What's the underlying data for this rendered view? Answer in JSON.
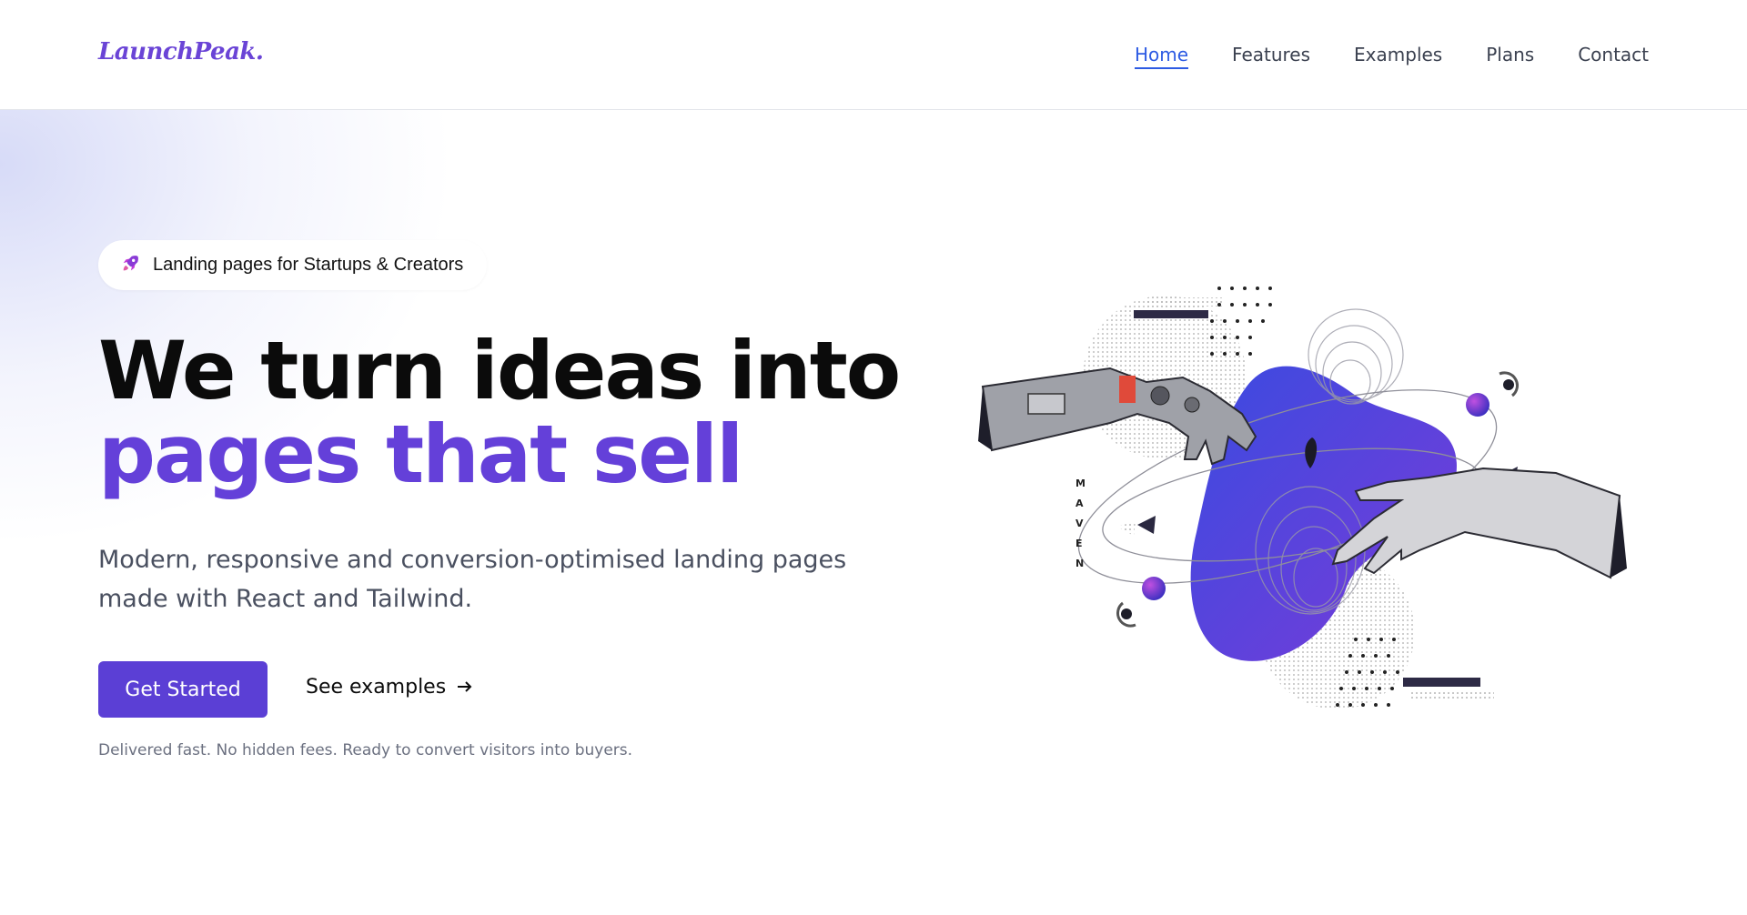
{
  "brand": {
    "logo_text": "LaunchPeak."
  },
  "nav": {
    "items": [
      {
        "label": "Home",
        "active": true
      },
      {
        "label": "Features",
        "active": false
      },
      {
        "label": "Examples",
        "active": false
      },
      {
        "label": "Plans",
        "active": false
      },
      {
        "label": "Contact",
        "active": false
      }
    ]
  },
  "hero": {
    "badge": {
      "icon": "rocket-icon",
      "text": "Landing pages for Startups & Creators"
    },
    "headline_line1": "We turn ideas into",
    "headline_line2": "pages that sell",
    "subtitle": "Modern, responsive and conversion-optimised landing pages made with React and Tailwind.",
    "cta_label": "Get Started",
    "secondary_label": "See examples",
    "secondary_icon": "arrow-right-icon",
    "note": "Delivered fast. No hidden fees. Ready to convert visitors into buyers."
  },
  "illustration": {
    "vertical_text": "MAVEN"
  },
  "colors": {
    "accent": "#5b3fd5",
    "headline_accent": "#6440d9",
    "nav_active": "#2d5be3",
    "logo": "#6a44d6"
  }
}
